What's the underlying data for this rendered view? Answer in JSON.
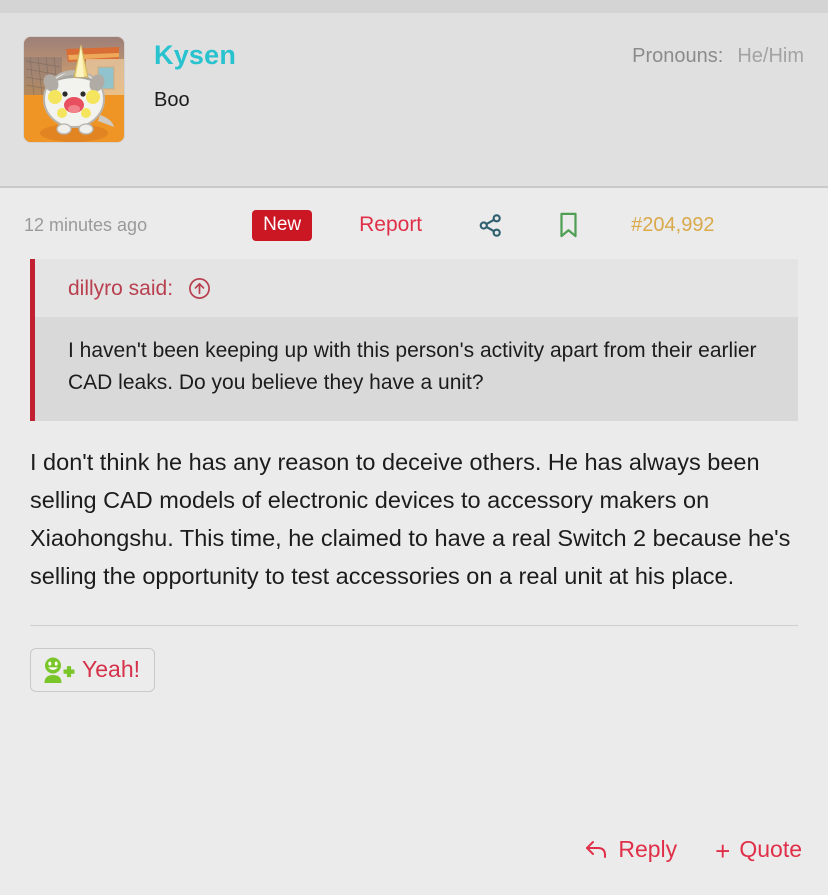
{
  "post": {
    "author": {
      "username": "Kysen",
      "user_title": "Boo",
      "avatar_icon": "pokemon-avatar",
      "pronouns_label": "Pronouns:",
      "pronouns_value": "He/Him"
    },
    "meta": {
      "timestamp": "12 minutes ago",
      "new_badge": "New",
      "report_label": "Report",
      "share_icon": "share-icon",
      "bookmark_icon": "bookmark-icon",
      "post_number": "#204,992"
    },
    "quote": {
      "author_line": "dillyro said:",
      "jump_icon": "circled-up-arrow-icon",
      "text": "I haven't been keeping up with this person's activity apart from their earlier CAD leaks. Do you believe they have a unit?"
    },
    "body": "I don't think he has any reason to deceive others. He has always been selling CAD models of electronic devices to accessory makers on Xiaohongshu. This time, he claimed to have a real Switch 2 because he's selling the opportunity to test accessories on a real unit at his place.",
    "reactions": [
      {
        "icon": "add-reaction-icon",
        "label": "Yeah!"
      }
    ],
    "footer": {
      "reply_icon": "reply-arrow-icon",
      "reply_label": "Reply",
      "quote_plus_icon": "plus-icon",
      "quote_label": "Quote"
    }
  },
  "colors": {
    "username": "#29c3cf",
    "accent_red": "#e03049",
    "badge_red": "#cb1724",
    "quote_bar": "#c21f33",
    "post_number": "#d9a94a",
    "bookmark_green": "#4e9e54",
    "share_teal": "#2e5f6e",
    "reaction_green": "#7ac52a",
    "page_bg": "#ebebeb",
    "header_bg": "#e0e0e0"
  }
}
